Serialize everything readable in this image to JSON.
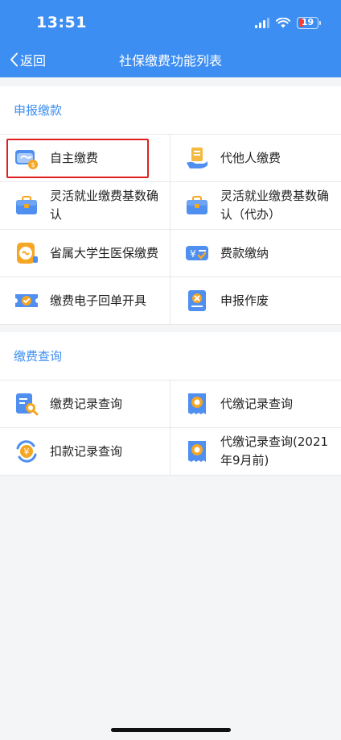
{
  "status_bar": {
    "time": "13:51",
    "battery": "19"
  },
  "nav": {
    "back_label": "返回",
    "title": "社保缴费功能列表"
  },
  "sections": [
    {
      "title": "申报缴款",
      "items": [
        {
          "label": "自主缴费",
          "icon": "card-icon"
        },
        {
          "label": "代他人缴费",
          "icon": "hand-document-icon"
        },
        {
          "label": "灵活就业缴费基数确认",
          "icon": "briefcase-icon"
        },
        {
          "label": "灵活就业缴费基数确认（代办）",
          "icon": "briefcase-icon"
        },
        {
          "label": "省属大学生医保缴费",
          "icon": "coin-icon"
        },
        {
          "label": "费款缴纳",
          "icon": "yuan-card-icon"
        },
        {
          "label": "缴费电子回单开具",
          "icon": "ticket-check-icon"
        },
        {
          "label": "申报作废",
          "icon": "document-cancel-icon"
        }
      ]
    },
    {
      "title": "缴费查询",
      "items": [
        {
          "label": "缴费记录查询",
          "icon": "document-search-icon"
        },
        {
          "label": "代缴记录查询",
          "icon": "receipt-search-icon"
        },
        {
          "label": "扣款记录查询",
          "icon": "yuan-refresh-icon"
        },
        {
          "label": "代缴记录查询(2021年9月前)",
          "icon": "receipt-search-icon"
        }
      ]
    }
  ],
  "colors": {
    "nav_bg": "#3d8ef2",
    "section_title": "#3d8ef2",
    "highlight_border": "#e02020"
  }
}
